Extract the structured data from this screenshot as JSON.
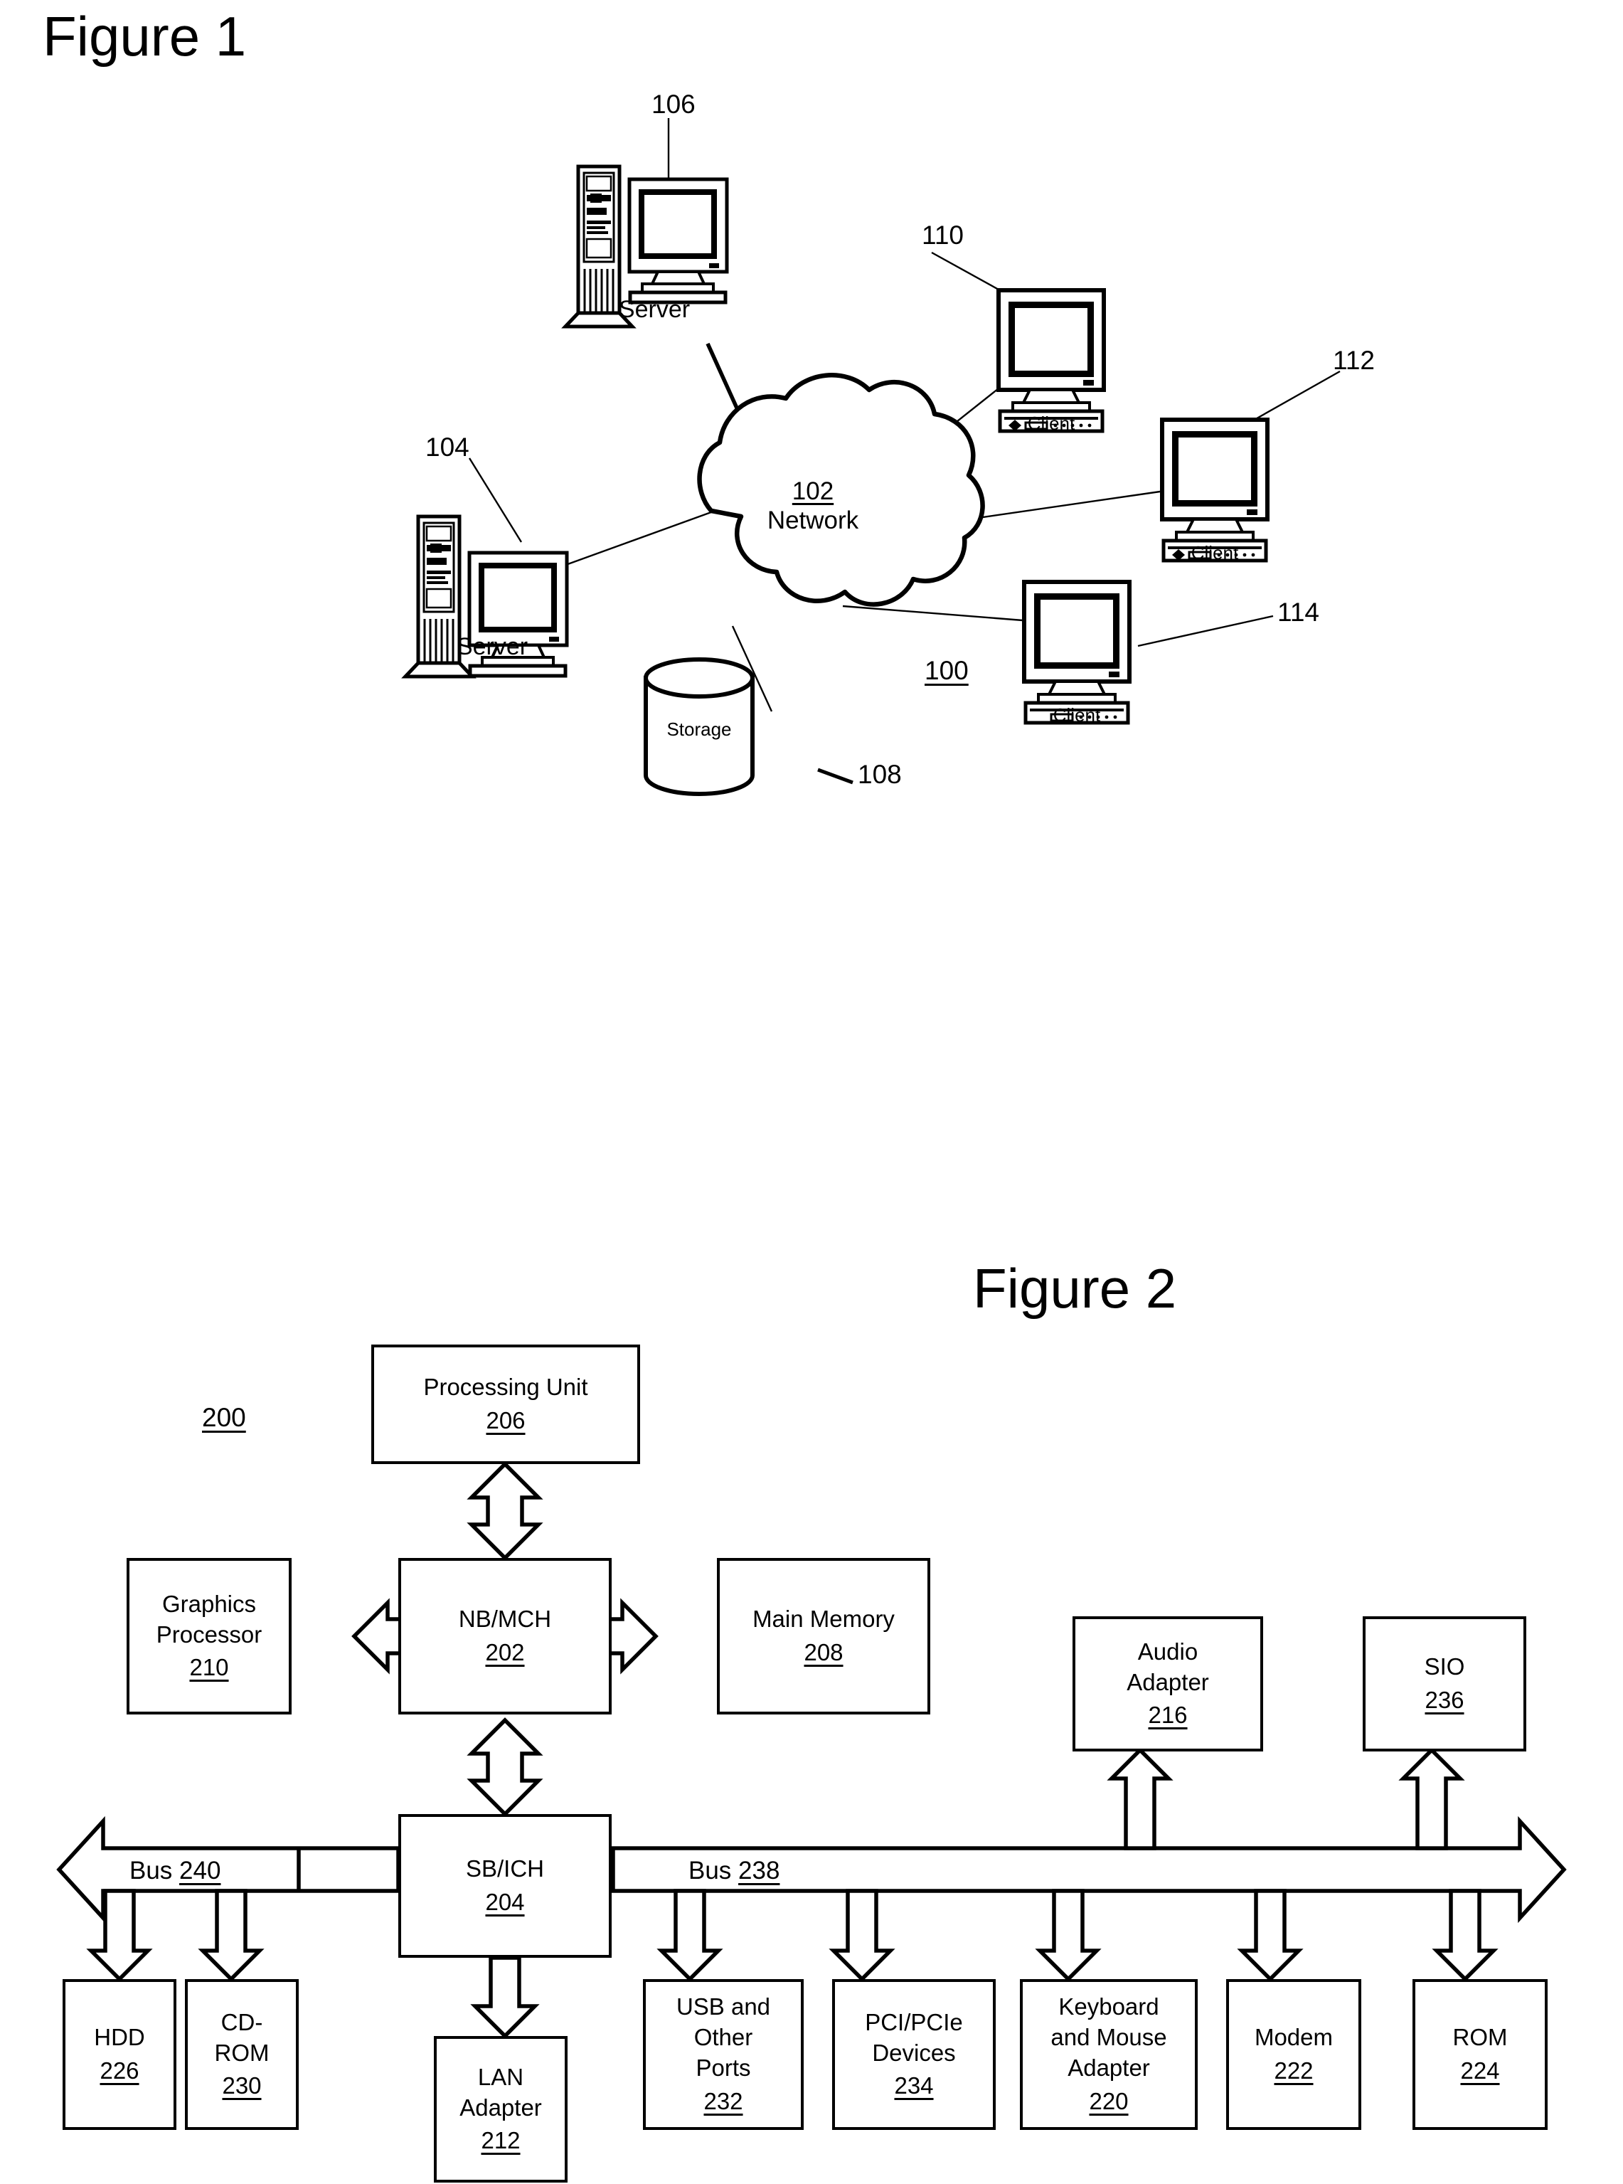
{
  "document": {
    "background_color": "#ffffff",
    "line_color": "#000000"
  },
  "figure1": {
    "title": "Figure 1",
    "system_ref": "100",
    "network": {
      "ref": "102",
      "label": "Network"
    },
    "nodes": [
      {
        "id": "server-106",
        "type": "server",
        "label": "Server",
        "ref": "106"
      },
      {
        "id": "server-104",
        "type": "server",
        "label": "Server",
        "ref": "104"
      },
      {
        "id": "client-110",
        "type": "client",
        "label": "Client",
        "ref": "110"
      },
      {
        "id": "client-112",
        "type": "client",
        "label": "Client",
        "ref": "112"
      },
      {
        "id": "client-114",
        "type": "client",
        "label": "Client",
        "ref": "114"
      },
      {
        "id": "storage-108",
        "type": "storage",
        "label": "Storage",
        "ref": "108"
      }
    ]
  },
  "figure2": {
    "title": "Figure 2",
    "system_ref": "200",
    "buses": [
      {
        "id": "bus-240",
        "prefix": "Bus ",
        "ref": "240"
      },
      {
        "id": "bus-238",
        "prefix": "Bus ",
        "ref": "238"
      }
    ],
    "blocks": [
      {
        "id": "processing-unit",
        "label": "Processing Unit",
        "ref": "206"
      },
      {
        "id": "graphics-processor",
        "label": "Graphics\nProcessor",
        "ref": "210"
      },
      {
        "id": "nb-mch",
        "label": "NB/MCH",
        "ref": "202"
      },
      {
        "id": "main-memory",
        "label": "Main Memory",
        "ref": "208"
      },
      {
        "id": "audio-adapter",
        "label": "Audio\nAdapter",
        "ref": "216"
      },
      {
        "id": "sio",
        "label": "SIO",
        "ref": "236"
      },
      {
        "id": "sb-ich",
        "label": "SB/ICH",
        "ref": "204"
      },
      {
        "id": "hdd",
        "label": "HDD",
        "ref": "226"
      },
      {
        "id": "cd-rom",
        "label": "CD-\nROM",
        "ref": "230"
      },
      {
        "id": "lan-adapter",
        "label": "LAN\nAdapter",
        "ref": "212"
      },
      {
        "id": "usb-other-ports",
        "label": "USB and\nOther\nPorts",
        "ref": "232"
      },
      {
        "id": "pci-pcie-devices",
        "label": "PCI/PCIe\nDevices",
        "ref": "234"
      },
      {
        "id": "keyboard-mouse-adapter",
        "label": "Keyboard\nand Mouse\nAdapter",
        "ref": "220"
      },
      {
        "id": "modem",
        "label": "Modem",
        "ref": "222"
      },
      {
        "id": "rom",
        "label": "ROM",
        "ref": "224"
      }
    ],
    "block_labels": {
      "processing_unit": "Processing Unit",
      "processing_unit_ref": "206",
      "graphics_processor_line1": "Graphics",
      "graphics_processor_line2": "Processor",
      "graphics_processor_ref": "210",
      "nb_mch": "NB/MCH",
      "nb_mch_ref": "202",
      "main_memory": "Main Memory",
      "main_memory_ref": "208",
      "audio_adapter_line1": "Audio",
      "audio_adapter_line2": "Adapter",
      "audio_adapter_ref": "216",
      "sio": "SIO",
      "sio_ref": "236",
      "sb_ich": "SB/ICH",
      "sb_ich_ref": "204",
      "hdd": "HDD",
      "hdd_ref": "226",
      "cdrom_line1": "CD-",
      "cdrom_line2": "ROM",
      "cdrom_ref": "230",
      "lan_line1": "LAN",
      "lan_line2": "Adapter",
      "lan_ref": "212",
      "usb_line1": "USB and",
      "usb_line2": "Other",
      "usb_line3": "Ports",
      "usb_ref": "232",
      "pci_line1": "PCI/PCIe",
      "pci_line2": "Devices",
      "pci_ref": "234",
      "kbm_line1": "Keyboard",
      "kbm_line2": "and Mouse",
      "kbm_line3": "Adapter",
      "kbm_ref": "220",
      "modem": "Modem",
      "modem_ref": "222",
      "rom": "ROM",
      "rom_ref": "224"
    },
    "bus_labels": {
      "bus240_prefix": "Bus ",
      "bus240_ref": "240",
      "bus238_prefix": "Bus ",
      "bus238_ref": "238"
    }
  }
}
